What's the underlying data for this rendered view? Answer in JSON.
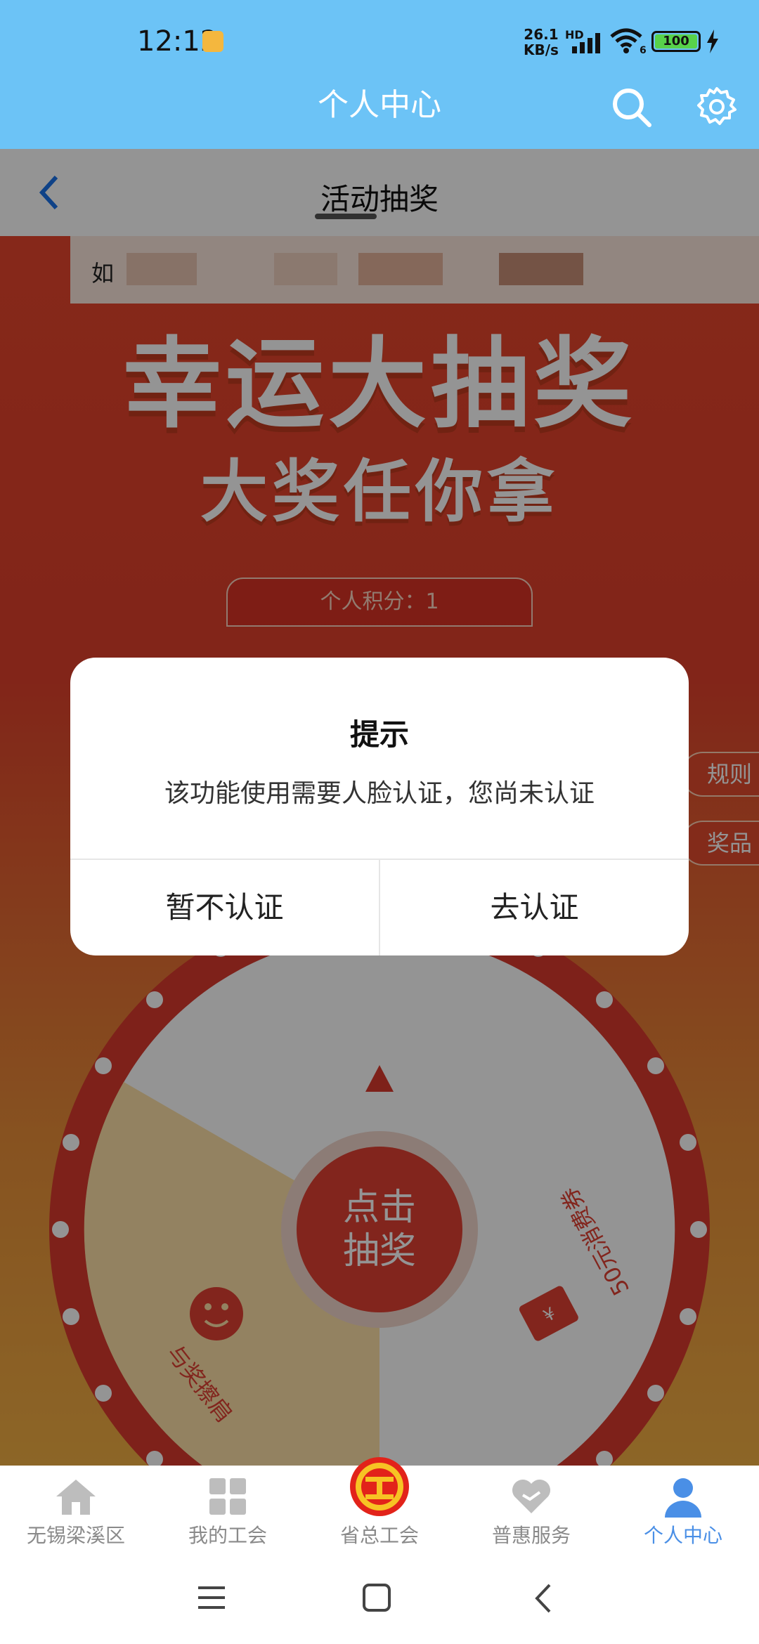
{
  "status_bar": {
    "time": "12:12",
    "net_speed_value": "26.1",
    "net_speed_unit": "KB/s",
    "network_badge": "HD",
    "wifi_badge": "6",
    "battery_level": "100",
    "battery_fraction": 1.0,
    "battery_color": "#58d24a"
  },
  "header": {
    "title": "个人中心",
    "search_icon": "search-icon",
    "settings_icon": "gear-icon",
    "background": "#6cc3f6"
  },
  "page": {
    "title": "活动抽奖",
    "notice_lead": "如",
    "banner_title": "幸运大抽奖",
    "banner_subtitle": "大奖任你拿",
    "points_label": "个人积分：",
    "points_value": "1",
    "rules_tab": "规则",
    "prizes_tab": "奖品"
  },
  "wheel": {
    "center_line1": "点击",
    "center_line2": "抽奖",
    "segments": [
      {
        "label": "与奖擦肩",
        "icon": "smiley-icon",
        "color": "#fde1a7"
      },
      {
        "label": "50元消费券",
        "icon": "coupon-icon",
        "color": "#ffffff"
      }
    ],
    "rim_color": "#d93a2e"
  },
  "dialog": {
    "title": "提示",
    "message": "该功能使用需要人脸认证，您尚未认证",
    "cancel_label": "暂不认证",
    "confirm_label": "去认证"
  },
  "tabbar": {
    "active_color": "#4a8fe6",
    "items": [
      {
        "label": "无锡梁溪区",
        "icon": "home-icon",
        "active": false
      },
      {
        "label": "我的工会",
        "icon": "grid-icon",
        "active": false
      },
      {
        "label": "省总工会",
        "icon": "union-logo-icon",
        "active": false
      },
      {
        "label": "普惠服务",
        "icon": "heart-icon",
        "active": false
      },
      {
        "label": "个人中心",
        "icon": "person-icon",
        "active": true
      }
    ]
  },
  "system_nav": {
    "menu_icon": "menu-icon",
    "home_icon": "home-square-icon",
    "back_icon": "back-icon"
  }
}
